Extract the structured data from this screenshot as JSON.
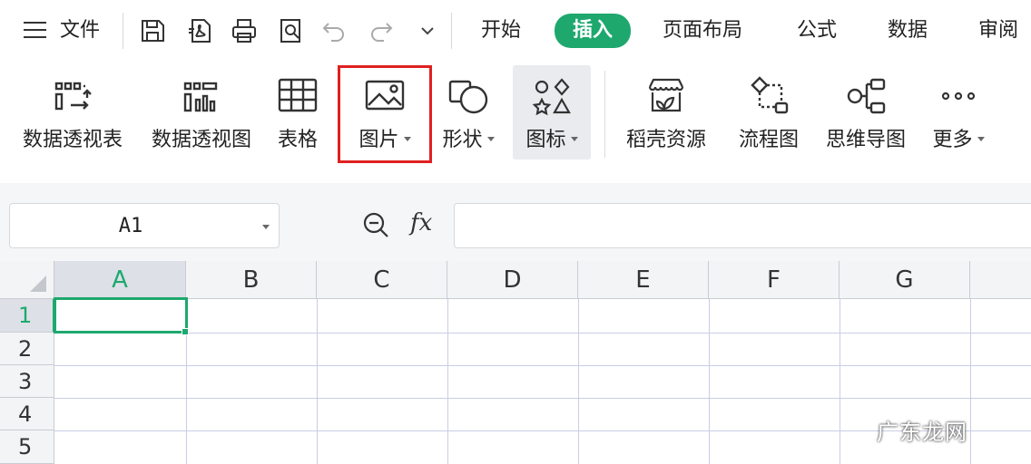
{
  "menubar": {
    "file_label": "文件",
    "tabs": [
      {
        "label": "开始"
      },
      {
        "label": "插入",
        "active": true
      },
      {
        "label": "页面布局"
      },
      {
        "label": "公式"
      },
      {
        "label": "数据"
      },
      {
        "label": "审阅"
      }
    ],
    "quick_access_icons": [
      "save-icon",
      "export-pdf-icon",
      "print-icon",
      "print-preview-icon",
      "undo-icon",
      "redo-icon",
      "customize-dropdown-icon"
    ]
  },
  "ribbon": {
    "buttons": [
      {
        "label": "数据透视表",
        "icon": "pivot-table-icon"
      },
      {
        "label": "数据透视图",
        "icon": "pivot-chart-icon"
      },
      {
        "label": "表格",
        "icon": "table-icon"
      },
      {
        "label": "图片",
        "icon": "picture-icon",
        "dropdown": true,
        "highlighted": true
      },
      {
        "label": "形状",
        "icon": "shape-icon",
        "dropdown": true
      },
      {
        "label": "图标",
        "icon": "icons-icon",
        "dropdown": true
      },
      {
        "label": "稻壳资源",
        "icon": "docer-resource-icon"
      },
      {
        "label": "流程图",
        "icon": "flowchart-icon"
      },
      {
        "label": "思维导图",
        "icon": "mindmap-icon"
      },
      {
        "label": "更多",
        "icon": "more-icon",
        "dropdown": true
      }
    ]
  },
  "formula_bar": {
    "name_box": "A1",
    "fx_label": "fx",
    "formula_value": ""
  },
  "grid": {
    "columns": [
      "A",
      "B",
      "C",
      "D",
      "E",
      "F",
      "G"
    ],
    "rows": [
      "1",
      "2",
      "3",
      "4",
      "5"
    ],
    "active_cell": "A1"
  },
  "watermark": "广东龙网",
  "colors": {
    "accent": "#1ea86e",
    "highlight_box": "#e02020",
    "header_bg": "#f3f4f6",
    "gridline": "#c9cde6"
  }
}
